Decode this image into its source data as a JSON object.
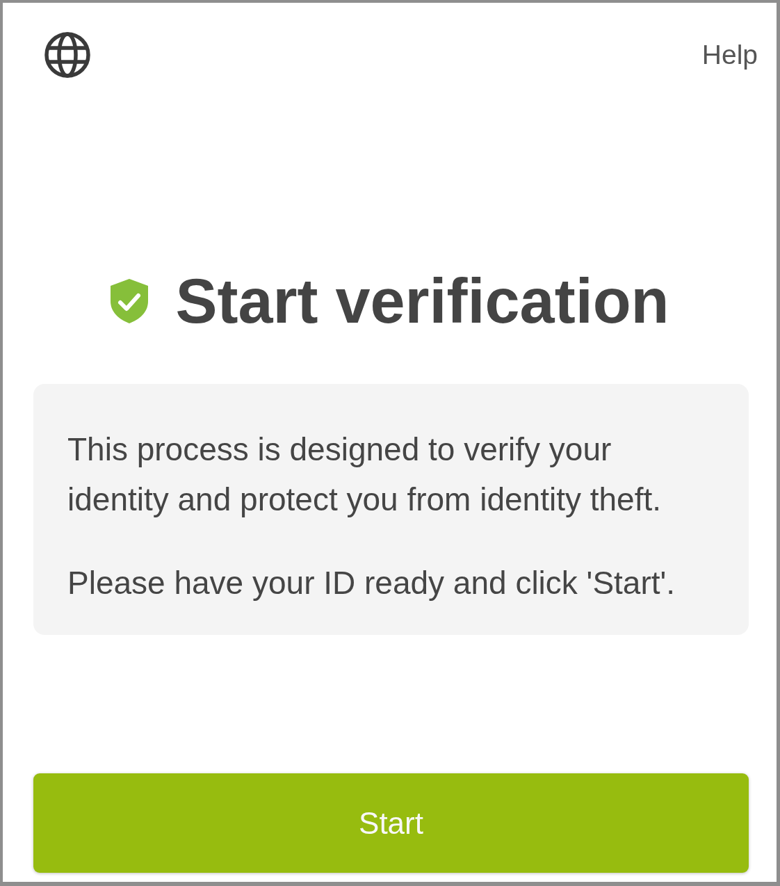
{
  "header": {
    "help_link": "Help"
  },
  "title": "Start verification",
  "intro": {
    "paragraphs": [
      "This process is designed to verify your identity and protect you from identity theft.",
      "Please have your ID ready and click 'Start'."
    ]
  },
  "start_button": "Start"
}
